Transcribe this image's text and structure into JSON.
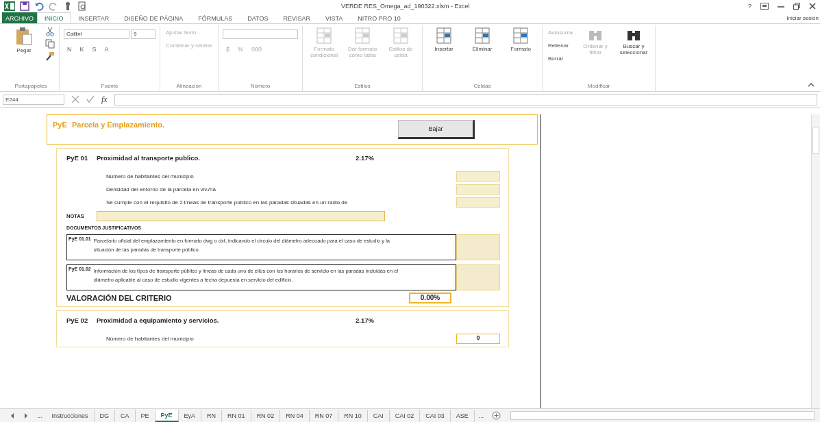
{
  "window": {
    "title": "VERDE RES_Omega_ad_190322.xlsm - Excel",
    "help": "?"
  },
  "ribbon_tabs": [
    {
      "label": "ARCHIVO",
      "kind": "file",
      "selected": false
    },
    {
      "label": "INICIO",
      "kind": "tab",
      "selected": true
    },
    {
      "label": "INSERTAR",
      "kind": "tab",
      "selected": false
    },
    {
      "label": "DISEÑO DE PÁGINA",
      "kind": "tab",
      "selected": false
    },
    {
      "label": "FÓRMULAS",
      "kind": "tab",
      "selected": false
    },
    {
      "label": "DATOS",
      "kind": "tab",
      "selected": false
    },
    {
      "label": "REVISAR",
      "kind": "tab",
      "selected": false
    },
    {
      "label": "VISTA",
      "kind": "tab",
      "selected": false
    },
    {
      "label": "NITRO PRO 10",
      "kind": "tab",
      "selected": false
    }
  ],
  "account": "Iniciar sesión",
  "ribbon_groups": [
    {
      "label": "Portapapeles",
      "kind": "clipboard",
      "commands": [
        {
          "label": "Pegar",
          "disabled": false
        }
      ]
    },
    {
      "label": "Fuente",
      "kind": "font",
      "font": "Calibri",
      "size": "9",
      "format_buttons": [
        "N",
        "K",
        "S",
        "A"
      ]
    },
    {
      "label": "Alineación",
      "kind": "commands",
      "commands": [
        {
          "label": "Ajustar texto",
          "disabled": true
        },
        {
          "label": "Combinar y centrar",
          "disabled": true
        }
      ]
    },
    {
      "label": "Número",
      "kind": "number",
      "format_buttons": [
        "$",
        "%",
        "000"
      ]
    },
    {
      "label": "Estilos",
      "kind": "large",
      "commands": [
        {
          "label": "Formato condicional",
          "disabled": true
        },
        {
          "label": "Dar formato como tabla",
          "disabled": true
        },
        {
          "label": "Estilos de celda",
          "disabled": true
        }
      ]
    },
    {
      "label": "Celdas",
      "kind": "large",
      "commands": [
        {
          "label": "Insertar",
          "disabled": false
        },
        {
          "label": "Eliminar",
          "disabled": false
        },
        {
          "label": "Formato",
          "disabled": false
        }
      ]
    },
    {
      "label": "Modificar",
      "kind": "edit",
      "commands": [
        {
          "label": "Autosuma",
          "disabled": true
        },
        {
          "label": "Rellenar",
          "disabled": false
        },
        {
          "label": "Borrar",
          "disabled": false
        }
      ],
      "large_commands": [
        {
          "label": "Ordenar y filtrar",
          "disabled": true
        },
        {
          "label": "Buscar y seleccionar",
          "disabled": false
        }
      ]
    }
  ],
  "formula_bar": {
    "name_box": "E244",
    "fx": "fx"
  },
  "sheet": {
    "code": "PyE",
    "title": "Parcela y Emplazamiento.",
    "button": "Bajar",
    "criteria": [
      {
        "code": "PyE 01",
        "title": "Proximidad al transporte publico.",
        "weight": "2.17%",
        "fields": [
          {
            "label": "Número de habitantes del municipio"
          },
          {
            "label": "Densidad del entorno de la parcela en viv./ha"
          },
          {
            "label": "Se cumple con el requisito de 2 líneas de transporte público en las paradas situadas en un radio de"
          }
        ],
        "notes_label": "NOTAS",
        "docs_label": "DOCUMENTOS JUSTIFICATIVOS",
        "docs": [
          {
            "code": "PyE 01.01",
            "text": "Parcelario oficial del emplazamiento en formato dwg o dxf, indicando el círculo del diámetro adecuado para el caso de estudio y la situación de las paradas de transporte público."
          },
          {
            "code": "PyE 01.02",
            "text": "Información de los tipos de transporte público y líneas de cada uno de ellos con los horarios de servicio en las paradas incluidas en el diámetro aplicable al caso de estudio vigentes a fecha depuesta en servicio del edificio."
          }
        ],
        "score_label": "VALORACIÓN DEL CRITERIO",
        "score": "0.00%"
      },
      {
        "code": "PyE 02",
        "title": "Proximidad a equipamiento y servicios.",
        "weight": "2.17%",
        "fields": [
          {
            "label": "Número de habitantes del municipio",
            "value": "0"
          }
        ]
      }
    ]
  },
  "sheet_tabs": {
    "more_left": "...",
    "more_right": "...",
    "tabs": [
      {
        "label": "Instrucciones",
        "selected": false
      },
      {
        "label": "DG",
        "selected": false
      },
      {
        "label": "CA",
        "selected": false
      },
      {
        "label": "PE",
        "selected": false
      },
      {
        "label": "PyE",
        "selected": true
      },
      {
        "label": "EyA",
        "selected": false
      },
      {
        "label": "RN",
        "selected": false
      },
      {
        "label": "RN 01",
        "selected": false
      },
      {
        "label": "RN 02",
        "selected": false
      },
      {
        "label": "RN 04",
        "selected": false
      },
      {
        "label": "RN 07",
        "selected": false
      },
      {
        "label": "RN 10",
        "selected": false
      },
      {
        "label": "CAI",
        "selected": false
      },
      {
        "label": "CAI 02",
        "selected": false
      },
      {
        "label": "CAI 03",
        "selected": false
      },
      {
        "label": "ASE",
        "selected": false
      }
    ]
  }
}
